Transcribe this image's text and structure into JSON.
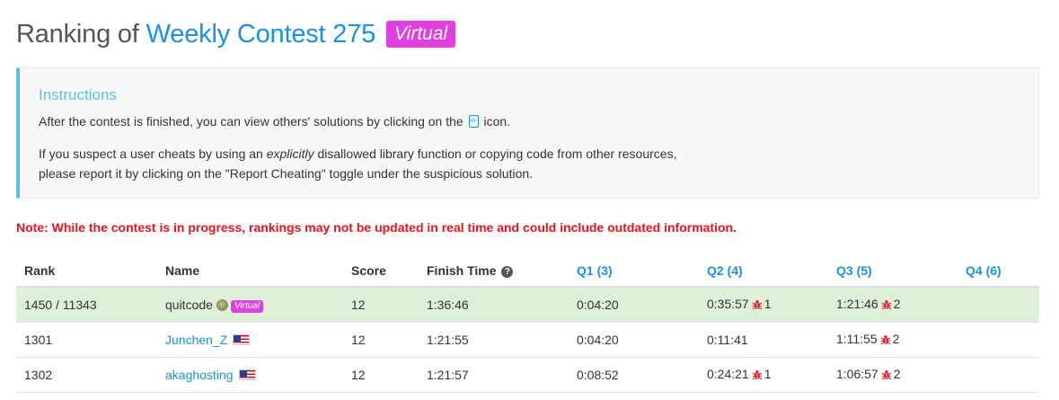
{
  "header": {
    "prefix": "Ranking of",
    "contest_name": "Weekly Contest 275",
    "virtual_badge": "Virtual"
  },
  "instructions": {
    "title": "Instructions",
    "line1_before": "After the contest is finished, you can view others' solutions by clicking on the",
    "line1_after": "icon.",
    "line2_before": "If you suspect a user cheats by using an",
    "line2_emph": "explicitly",
    "line2_after": "disallowed library function or copying code from other resources,",
    "line3": "please report it by clicking on the \"Report Cheating\" toggle under the suspicious solution."
  },
  "note": "Note: While the contest is in progress, rankings may not be updated in real time and could include outdated information.",
  "table": {
    "headers": {
      "rank": "Rank",
      "name": "Name",
      "score": "Score",
      "finish_time": "Finish Time",
      "q1": "Q1 (3)",
      "q2": "Q2 (4)",
      "q3": "Q3 (5)",
      "q4": "Q4 (6)"
    },
    "rows": [
      {
        "rank": "1450 / 11343",
        "name": "quitcode",
        "badge": "Virtual",
        "score": "12",
        "finish_time": "1:36:46",
        "q1": "0:04:20",
        "q2": "0:35:57",
        "q2_wa": "1",
        "q3": "1:21:46",
        "q3_wa": "2",
        "q4": ""
      },
      {
        "rank": "1301",
        "name": "Junchen_Z",
        "score": "12",
        "finish_time": "1:21:55",
        "q1": "0:04:20",
        "q2": "0:11:41",
        "q3": "1:11:55",
        "q3_wa": "2",
        "q4": ""
      },
      {
        "rank": "1302",
        "name": "akaghosting",
        "score": "12",
        "finish_time": "1:21:57",
        "q1": "0:08:52",
        "q2": "0:24:21",
        "q2_wa": "1",
        "q3": "1:06:57",
        "q3_wa": "2",
        "q4": ""
      }
    ]
  },
  "colors": {
    "link": "#1a90e8",
    "virtual_badge": "#e040e0",
    "note": "#e8141b",
    "highlight_row": "#dff0d8",
    "instructions_accent": "#5bc0de"
  }
}
